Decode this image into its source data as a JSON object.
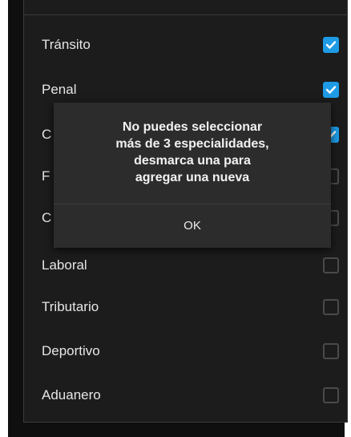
{
  "list": {
    "items": [
      {
        "label": "Tránsito",
        "checked": true
      },
      {
        "label": "Penal",
        "checked": true
      },
      {
        "label": "C",
        "checked": true
      },
      {
        "label": "F",
        "checked": false
      },
      {
        "label": "C",
        "checked": false
      },
      {
        "label": "Laboral",
        "checked": false
      },
      {
        "label": "Tributario",
        "checked": false
      },
      {
        "label": "Deportivo",
        "checked": false
      },
      {
        "label": "Aduanero",
        "checked": false
      }
    ]
  },
  "dialog": {
    "message": "No puedes seleccionar\nmás de 3 especialidades,\ndesmarca una para\nagregar una nueva",
    "ok_label": "OK"
  },
  "colors": {
    "accent": "#1e9be6",
    "panel": "#1c1c1c",
    "dialog": "#2c2c2c"
  }
}
